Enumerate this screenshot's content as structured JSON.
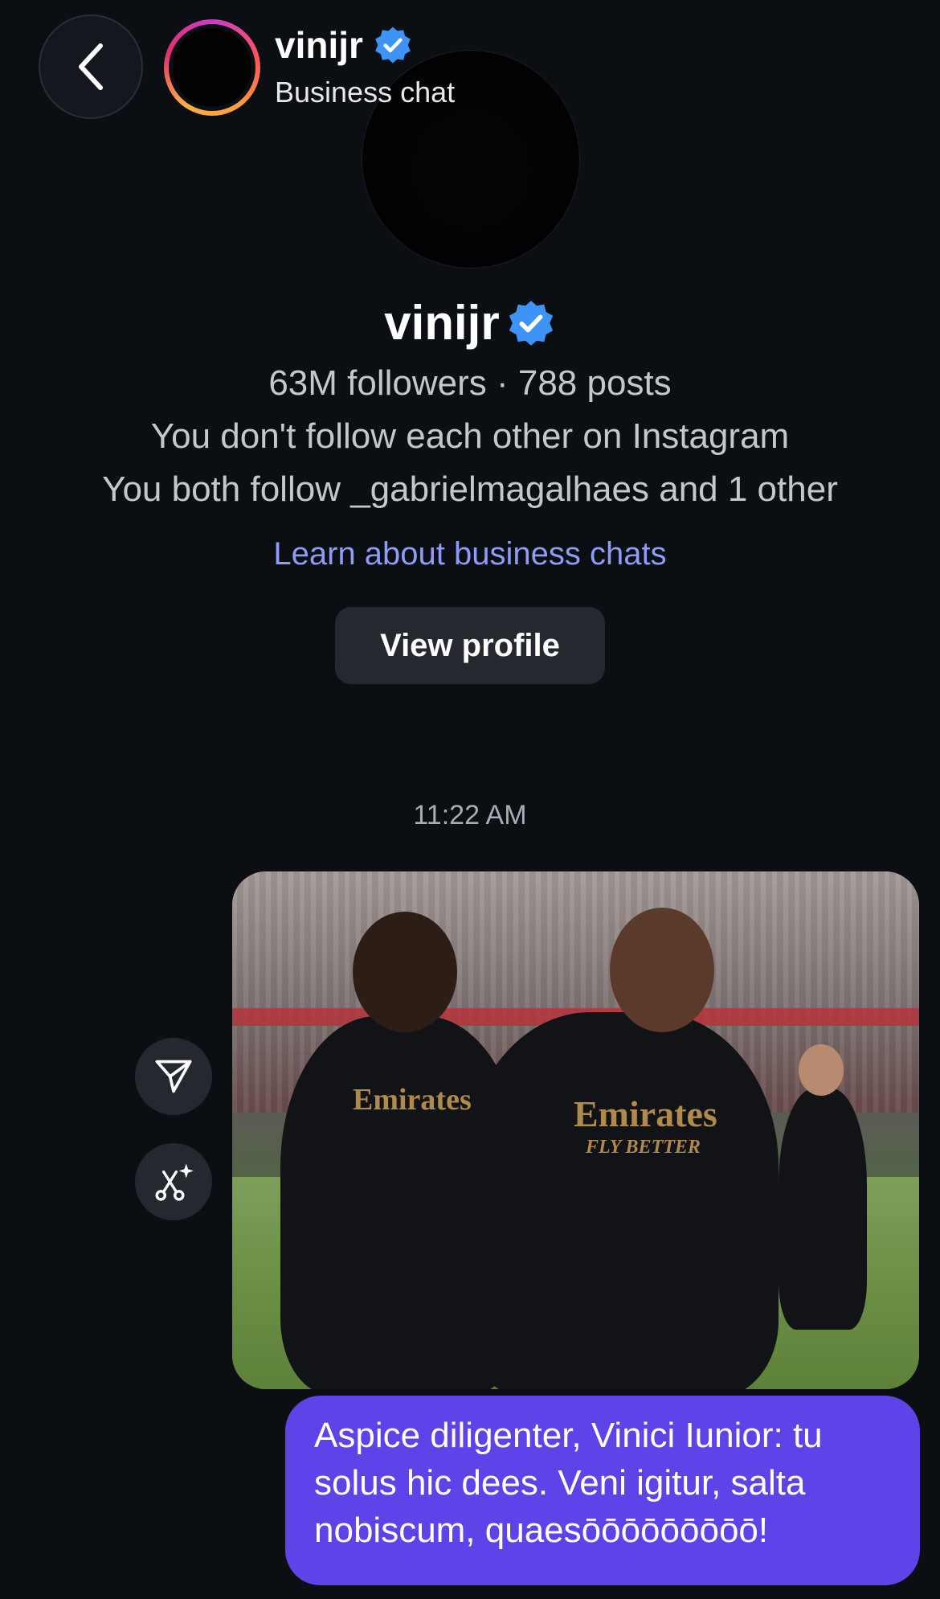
{
  "header": {
    "username": "vinijr",
    "subtitle": "Business chat"
  },
  "profile": {
    "name": "vinijr",
    "stats": "63M followers · 788 posts",
    "follow_status": "You don't follow each other on Instagram",
    "mutual_follow": "You both follow _gabrielmagalhaes and 1 other",
    "learn_link": "Learn about business chats",
    "view_profile_label": "View profile"
  },
  "conversation": {
    "timestamp": "11:22 AM",
    "photo_jersey_text": "Emirates",
    "photo_jersey_subtext": "FLY BETTER",
    "message_text": "Aspice diligenter, Vinici Iunior: tu solus hic dees. Veni igitur, salta nobiscum, quaesōōōōōōōōō!"
  },
  "icons": {
    "back": "chevron-left-icon",
    "verified": "verified-badge-icon",
    "share": "paper-plane-icon",
    "edit": "ai-edit-icon"
  },
  "colors": {
    "background": "#0b0e13",
    "link": "#8f9bf7",
    "verified": "#3d94f6",
    "bubble": "#5e43e8",
    "button": "#25282e"
  }
}
